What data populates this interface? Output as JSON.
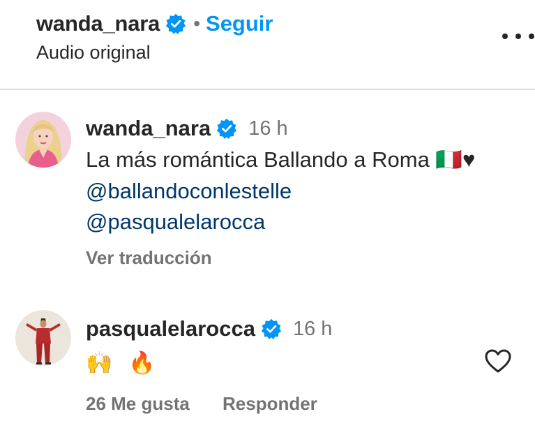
{
  "header": {
    "username": "wanda_nara",
    "separator": "•",
    "follow_label": "Seguir",
    "audio_label": "Audio original",
    "more_icon": "more-horizontal-icon"
  },
  "comments": [
    {
      "username": "wanda_nara",
      "time": "16 h",
      "text": "La más romántica Ballando a Roma 🇮🇹♥",
      "mentions": [
        "@ballandoconlestelle",
        "@pasqualelarocca"
      ],
      "translate_label": "Ver traducción"
    },
    {
      "username": "pasqualelarocca",
      "time": "16 h",
      "emojis": [
        "🙌",
        "🔥"
      ],
      "likes_label": "26 Me gusta",
      "reply_label": "Responder"
    }
  ],
  "colors": {
    "accent": "#0095f6",
    "mention": "#00376b",
    "muted": "#737373",
    "verified": "#0095f6"
  }
}
